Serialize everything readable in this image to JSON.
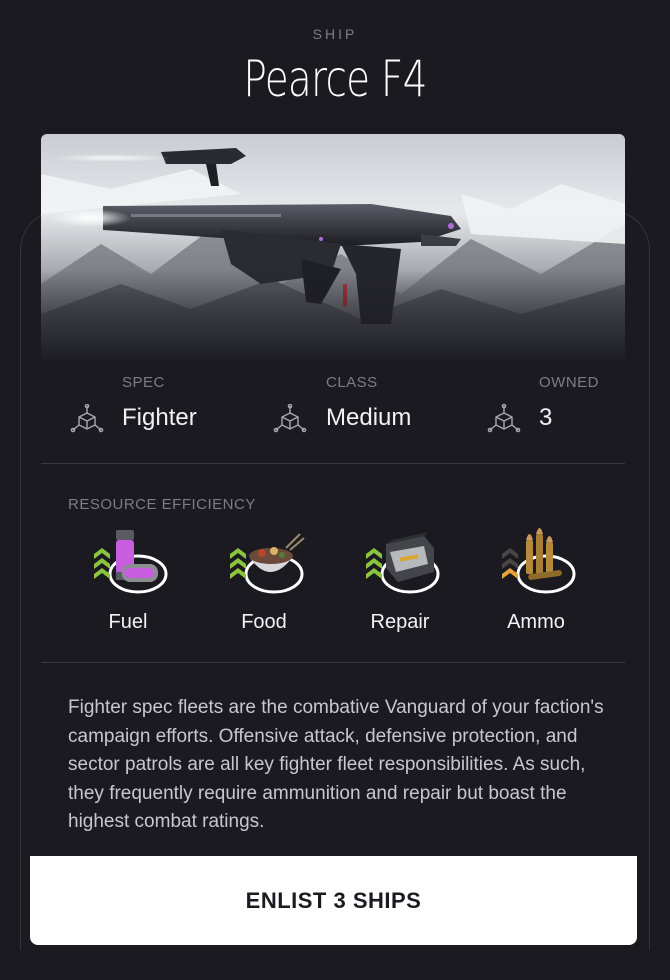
{
  "header": {
    "eyebrow": "SHIP",
    "title": "Pearce F4"
  },
  "hero": {
    "image": "fighter-ship-over-snowy-mountains"
  },
  "stats": [
    {
      "label": "SPEC",
      "value": "Fighter",
      "icon": "cube-nodes-icon"
    },
    {
      "label": "CLASS",
      "value": "Medium",
      "icon": "cube-nodes-icon"
    },
    {
      "label": "OWNED",
      "value": "3",
      "icon": "cube-nodes-icon"
    }
  ],
  "resources": {
    "label": "RESOURCE EFFICIENCY",
    "items": [
      {
        "name": "Fuel",
        "icon": "fuel-canister-icon",
        "efficiency_level": 3,
        "rating_color": "#8bc540"
      },
      {
        "name": "Food",
        "icon": "food-bowl-icon",
        "efficiency_level": 3,
        "rating_color": "#8bc540"
      },
      {
        "name": "Repair",
        "icon": "repair-kit-icon",
        "efficiency_level": 3,
        "rating_color": "#8bc540"
      },
      {
        "name": "Ammo",
        "icon": "ammo-bullets-icon",
        "efficiency_level": 1,
        "rating_color": "#e8a33a"
      }
    ]
  },
  "description": "Fighter spec fleets are the combative Vanguard of your faction's campaign efforts. Offensive attack, defensive protection, and sector patrols are all key fighter fleet responsibilities. As such, they frequently require ammunition and repair but boast the highest combat ratings.",
  "cta": {
    "label": "ENLIST 3 SHIPS"
  },
  "colors": {
    "background": "#1b1a21",
    "accent_good": "#8bc540",
    "accent_warn": "#e8a33a",
    "cta_bg": "#ffffff"
  }
}
